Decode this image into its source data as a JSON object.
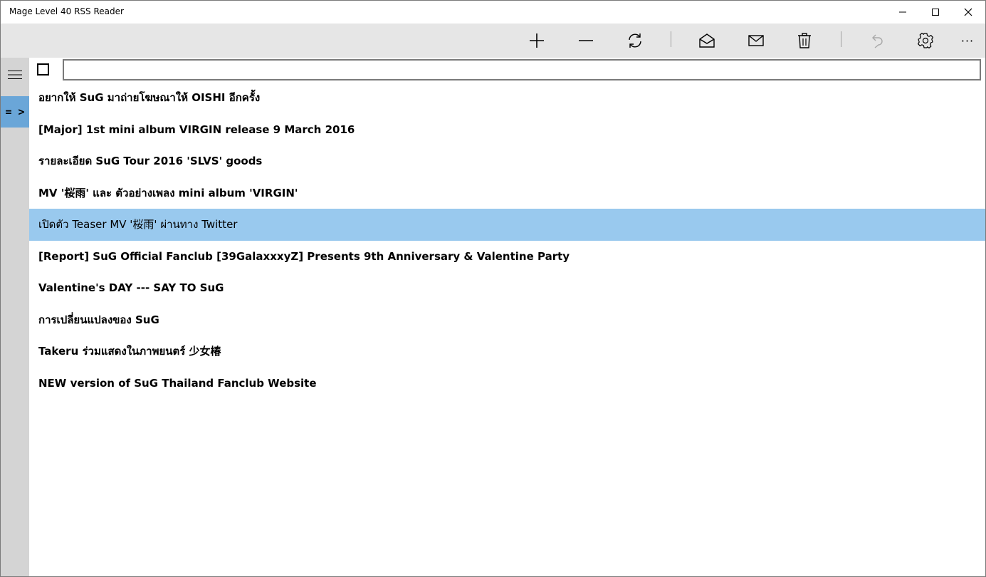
{
  "window": {
    "title": "Mage Level 40 RSS Reader"
  },
  "titlebar_buttons": [
    "minimize-icon",
    "maximize-icon",
    "close-icon"
  ],
  "toolbar": {
    "buttons": [
      {
        "name": "add-feed-button",
        "icon": "plus-icon"
      },
      {
        "name": "remove-feed-button",
        "icon": "minus-icon"
      },
      {
        "name": "refresh-button",
        "icon": "refresh-icon"
      },
      {
        "name": "mark-read-button",
        "icon": "envelope-open-icon"
      },
      {
        "name": "mark-unread-button",
        "icon": "envelope-icon"
      },
      {
        "name": "delete-button",
        "icon": "trash-icon"
      },
      {
        "name": "undo-button",
        "icon": "undo-icon",
        "disabled": true
      },
      {
        "name": "settings-button",
        "icon": "gear-icon"
      },
      {
        "name": "more-button",
        "icon": "ellipsis-icon"
      }
    ],
    "more_label": "···"
  },
  "sidebar": {
    "arrow_label": "= >"
  },
  "search": {
    "value": "",
    "placeholder": ""
  },
  "articles": [
    {
      "title": "อยากให้ SuG มาถ่ายโฆษณาให้ OISHI อีกครั้ง",
      "unread": true
    },
    {
      "title": "[Major] 1st mini album VIRGIN release 9 March 2016",
      "unread": true
    },
    {
      "title": "รายละเอียด SuG Tour 2016 'SLVS' goods",
      "unread": true
    },
    {
      "title": "MV  '桜雨' และ ตัวอย่างเพลง mini album 'VIRGIN'",
      "unread": true
    },
    {
      "title": "เปิดตัว Teaser MV '桜雨' ผ่านทาง Twitter",
      "unread": false,
      "selected": true
    },
    {
      "title": "[Report] SuG Official Fanclub [39GalaxxxyZ] Presents 9th Anniversary & Valentine Party",
      "unread": true
    },
    {
      "title": "Valentine's DAY --- SAY TO SuG",
      "unread": true
    },
    {
      "title": "การเปลี่ยนแปลงของ SuG",
      "unread": true
    },
    {
      "title": "Takeru ร่วมแสดงในภาพยนตร์ 少女椿",
      "unread": true
    },
    {
      "title": "NEW version of SuG Thailand Fanclub Website",
      "unread": true
    }
  ],
  "colors": {
    "toolbar_bg": "#e6e6e6",
    "sidebar_bg": "#d4d4d4",
    "sidebar_active": "#6aa6d8",
    "selected_row": "#99c9ee"
  }
}
